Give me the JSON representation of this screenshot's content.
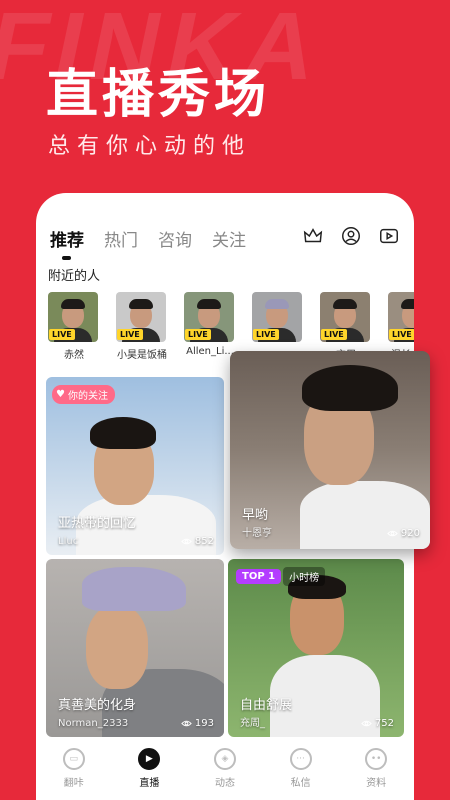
{
  "brand_watermark": "FINKA",
  "hero": {
    "title": "直播秀场",
    "subtitle": "总有你心动的他"
  },
  "tabs": [
    "推荐",
    "热门",
    "咨询",
    "关注"
  ],
  "tab_icons": [
    "crown-icon",
    "profile-circle-icon",
    "video-play-icon"
  ],
  "nearby": {
    "title": "附近的人",
    "live_label": "LIVE",
    "people": [
      {
        "name": "赤然",
        "bg": "#7a8a5a"
      },
      {
        "name": "小昊是饭桶",
        "bg": "#c9c9c9"
      },
      {
        "name": "Allen_Li...",
        "bg": "#86967a"
      },
      {
        "name": "...",
        "bg": "#a3a4a6"
      },
      {
        "name": "充周",
        "bg": "#8c8070"
      },
      {
        "name": "温长",
        "bg": "#9a8e80"
      }
    ]
  },
  "cards": [
    {
      "title": "亚热带的回忆",
      "user": "Lluc",
      "views": "852",
      "tag": "你的关注"
    },
    {
      "title": "早哟",
      "user": "十恩亨",
      "views": "920"
    },
    {
      "title": "真善美的化身",
      "user": "Norman_2333",
      "views": "193"
    },
    {
      "title": "自由舒展",
      "user": "充周_",
      "views": "752",
      "top": "TOP 1",
      "rank": "小时榜"
    }
  ],
  "bottom_nav": [
    {
      "label": "翻咔",
      "icon": "cards-icon",
      "active": false
    },
    {
      "label": "直播",
      "icon": "play-icon",
      "active": true
    },
    {
      "label": "动态",
      "icon": "compass-icon",
      "active": false
    },
    {
      "label": "私信",
      "icon": "chat-icon",
      "active": false
    },
    {
      "label": "资料",
      "icon": "face-icon",
      "active": false
    }
  ],
  "colors": {
    "brand_red": "#e7293a",
    "live_yellow": "#ffd52a",
    "top_purple": "#b43dff",
    "follow_pink": "#ff6a88"
  }
}
